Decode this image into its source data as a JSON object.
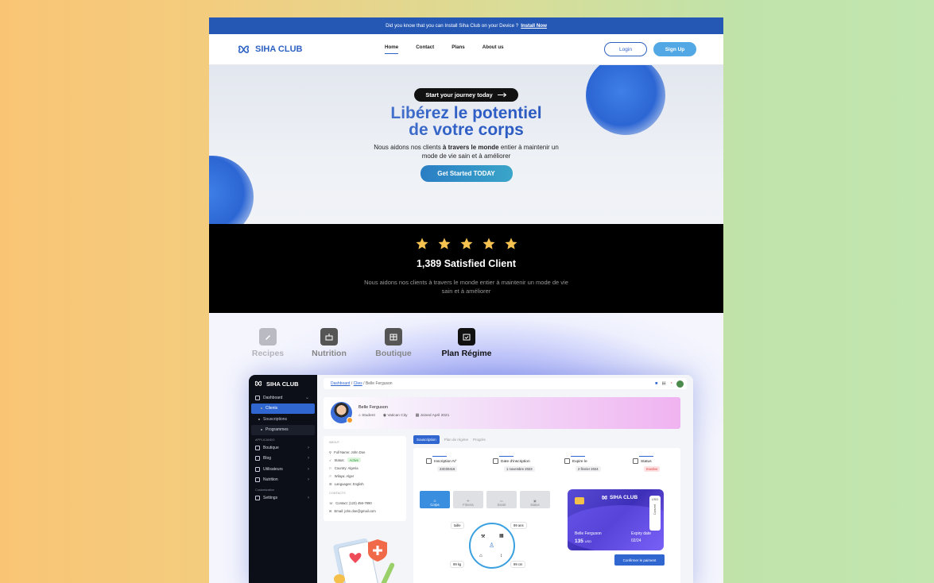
{
  "banner": {
    "text": "Did you know that you can Install Siha Club on your Device ?",
    "link": "Install Now"
  },
  "nav": {
    "logo": "SIHA CLUB",
    "items": [
      "Home",
      "Contact",
      "Plans",
      "About us"
    ],
    "login": "Login",
    "signup": "Sign Up"
  },
  "hero": {
    "pill": "Start your journey today",
    "title_line1": "Libérez le potentiel",
    "title_line2": "de votre corps",
    "desc_pre": "Nous aidons nos clients ",
    "desc_bold": "à travers le monde",
    "desc_post": " entier à maintenir un",
    "desc_line2": "mode de vie sain et à améliorer",
    "cta": "Get Started TODAY"
  },
  "rating": {
    "stars": 5,
    "headline": "1,389 Satisfied Client",
    "line1": "Nous aidons nos clients à travers le monde entier à maintenir un mode de vie",
    "line2": "sain et à améliorer"
  },
  "features": {
    "tabs": [
      {
        "label": "Recipes",
        "icon": "pen-icon",
        "state": "faded"
      },
      {
        "label": "Nutrition",
        "icon": "nutrition-icon",
        "state": "normal"
      },
      {
        "label": "Boutique",
        "icon": "shop-icon",
        "state": "normal"
      },
      {
        "label": "Plan Régime",
        "icon": "calendar-check-icon",
        "state": "active"
      }
    ]
  },
  "dashboard": {
    "logo": "SIHA CLUB",
    "sidebar": {
      "dashboard": "Dashboard",
      "clients": "Clients",
      "souscriptions": "Souscriptions",
      "programmes": "Programmes",
      "group_apps": "APPLICANDO",
      "boutique": "Boutique",
      "blog": "Blog",
      "utilisateurs": "Utilisateurs",
      "nutrition": "Nutrition",
      "group_custom": "Customization",
      "settings": "Settings"
    },
    "breadcrumb": {
      "a": "Dashboard",
      "b": "Clies",
      "c": "Belle Ferguson"
    },
    "profile": {
      "name": "Belle Ferguson",
      "role": "Student",
      "city": "Vatican City",
      "joined": "Joined April 2021"
    },
    "about": {
      "heading": "ABOUT",
      "full_name": "Full Name:  John Doe",
      "status_label": "Status:",
      "status_value": "Active",
      "country": "Country:  Algeria",
      "wilaya": "Wilaya:  Alger",
      "languages": "Languages:  English",
      "contacts_heading": "CONTACTS",
      "contact": "Contact:  (123) 456-7890",
      "email": "Email:  john.doe@gmail.com"
    },
    "tabs": {
      "a": "Souscription",
      "b": "Plan de régime",
      "c": "Progrès"
    },
    "stats": [
      {
        "label": "Inscription N°",
        "value": "23C00416"
      },
      {
        "label": "Date d'inscription",
        "value": "1 novembre 2023"
      },
      {
        "label": "Expire le",
        "value": "2 février 2024"
      },
      {
        "label": "Status",
        "value": "Inactive"
      }
    ],
    "chips": [
      "Corps",
      "Fitness",
      "Santé",
      "status"
    ],
    "ring": {
      "taille": "taille",
      "age": "99 ans",
      "poids": "99 kg",
      "tour": "99 cm"
    },
    "card": {
      "logo": "SIHA CLUB",
      "currency": "USD",
      "convert": "Convert",
      "holder": "Belle Ferguson",
      "amount": "135",
      "amount_unit": "USD",
      "expiry_label": "Expiry date",
      "expiry_value": "02/24"
    },
    "pay_button": "Confirmer le paiment"
  }
}
